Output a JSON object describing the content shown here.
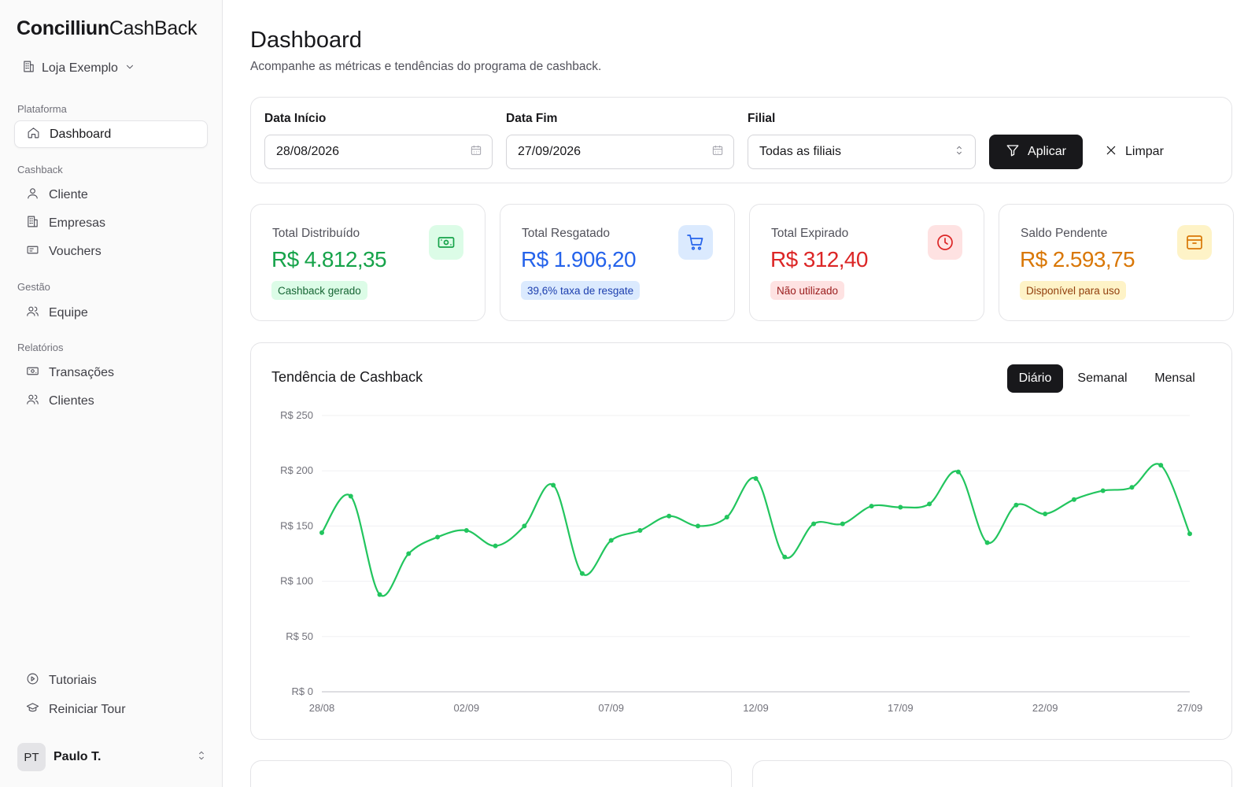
{
  "brand": {
    "bold": "Concilliun",
    "light": "CashBack"
  },
  "store": {
    "name": "Loja Exemplo"
  },
  "sidebar": {
    "sections": [
      {
        "label": "Plataforma"
      },
      {
        "label": "Cashback"
      },
      {
        "label": "Gestão"
      },
      {
        "label": "Relatórios"
      }
    ],
    "items": [
      {
        "label": "Dashboard",
        "icon": "home-icon",
        "active": true
      },
      {
        "label": "Cliente",
        "icon": "user-icon"
      },
      {
        "label": "Empresas",
        "icon": "building-icon"
      },
      {
        "label": "Vouchers",
        "icon": "ticket-icon"
      },
      {
        "label": "Equipe",
        "icon": "users-icon"
      },
      {
        "label": "Transações",
        "icon": "banknote-icon"
      },
      {
        "label": "Clientes",
        "icon": "users-icon"
      },
      {
        "label": "Tutoriais",
        "icon": "play-circle-icon"
      },
      {
        "label": "Reiniciar Tour",
        "icon": "graduation-cap-icon"
      }
    ],
    "user": {
      "initials": "PT",
      "name": "Paulo T."
    }
  },
  "header": {
    "title": "Dashboard",
    "subtitle": "Acompanhe as métricas e tendências do programa de cashback."
  },
  "filters": {
    "start_label": "Data Início",
    "start_value": "28/08/2026",
    "end_label": "Data Fim",
    "end_value": "27/09/2026",
    "branch_label": "Filial",
    "branch_value": "Todas as filiais",
    "apply_label": "Aplicar",
    "clear_label": "Limpar"
  },
  "kpis": [
    {
      "label": "Total Distribuído",
      "value": "R$ 4.812,35",
      "badge": "Cashback gerado",
      "color": "#16a34a",
      "badge_bg": "#dcfce7",
      "badge_fg": "#166534",
      "icon_bg": "#dcfce7",
      "icon": "banknote-icon"
    },
    {
      "label": "Total Resgatado",
      "value": "R$ 1.906,20",
      "badge": "39,6% taxa de resgate",
      "color": "#2563eb",
      "badge_bg": "#dbeafe",
      "badge_fg": "#1e40af",
      "icon_bg": "#dbeafe",
      "icon": "cart-icon"
    },
    {
      "label": "Total Expirado",
      "value": "R$ 312,40",
      "badge": "Não utilizado",
      "color": "#dc2626",
      "badge_bg": "#fee2e2",
      "badge_fg": "#991b1b",
      "icon_bg": "#fee2e2",
      "icon": "clock-icon"
    },
    {
      "label": "Saldo Pendente",
      "value": "R$ 2.593,75",
      "badge": "Disponível para uso",
      "color": "#d97706",
      "badge_bg": "#fef3c7",
      "badge_fg": "#92400e",
      "icon_bg": "#fef3c7",
      "icon": "wallet-icon"
    }
  ],
  "chart": {
    "title": "Tendência de Cashback",
    "periods": [
      "Diário",
      "Semanal",
      "Mensal"
    ],
    "active_period": "Diário"
  },
  "chart_data": {
    "type": "line",
    "title": "Tendência de Cashback",
    "x": [
      "28/08",
      "29/08",
      "30/08",
      "31/08",
      "01/09",
      "02/09",
      "03/09",
      "04/09",
      "05/09",
      "06/09",
      "07/09",
      "08/09",
      "09/09",
      "10/09",
      "11/09",
      "12/09",
      "13/09",
      "14/09",
      "15/09",
      "16/09",
      "17/09",
      "18/09",
      "19/09",
      "20/09",
      "21/09",
      "22/09",
      "23/09",
      "24/09",
      "25/09",
      "26/09",
      "27/09"
    ],
    "x_tick_labels": [
      "28/08",
      "02/09",
      "07/09",
      "12/09",
      "17/09",
      "22/09",
      "27/09"
    ],
    "series": [
      {
        "values": [
          144,
          177,
          88,
          125,
          140,
          146,
          132,
          150,
          187,
          107,
          137,
          146,
          159,
          150,
          158,
          193,
          122,
          152,
          152,
          168,
          167,
          170,
          199,
          135,
          169,
          161,
          174,
          182,
          185,
          205,
          143
        ],
        "color": "#22c55e"
      }
    ],
    "ylim": [
      0,
      250
    ],
    "y_ticks": [
      0,
      50,
      100,
      150,
      200,
      250
    ],
    "y_tick_labels": [
      "R$ 0",
      "R$ 50",
      "R$ 100",
      "R$ 150",
      "R$ 200",
      "R$ 250"
    ],
    "grid": true,
    "legend": "none"
  }
}
